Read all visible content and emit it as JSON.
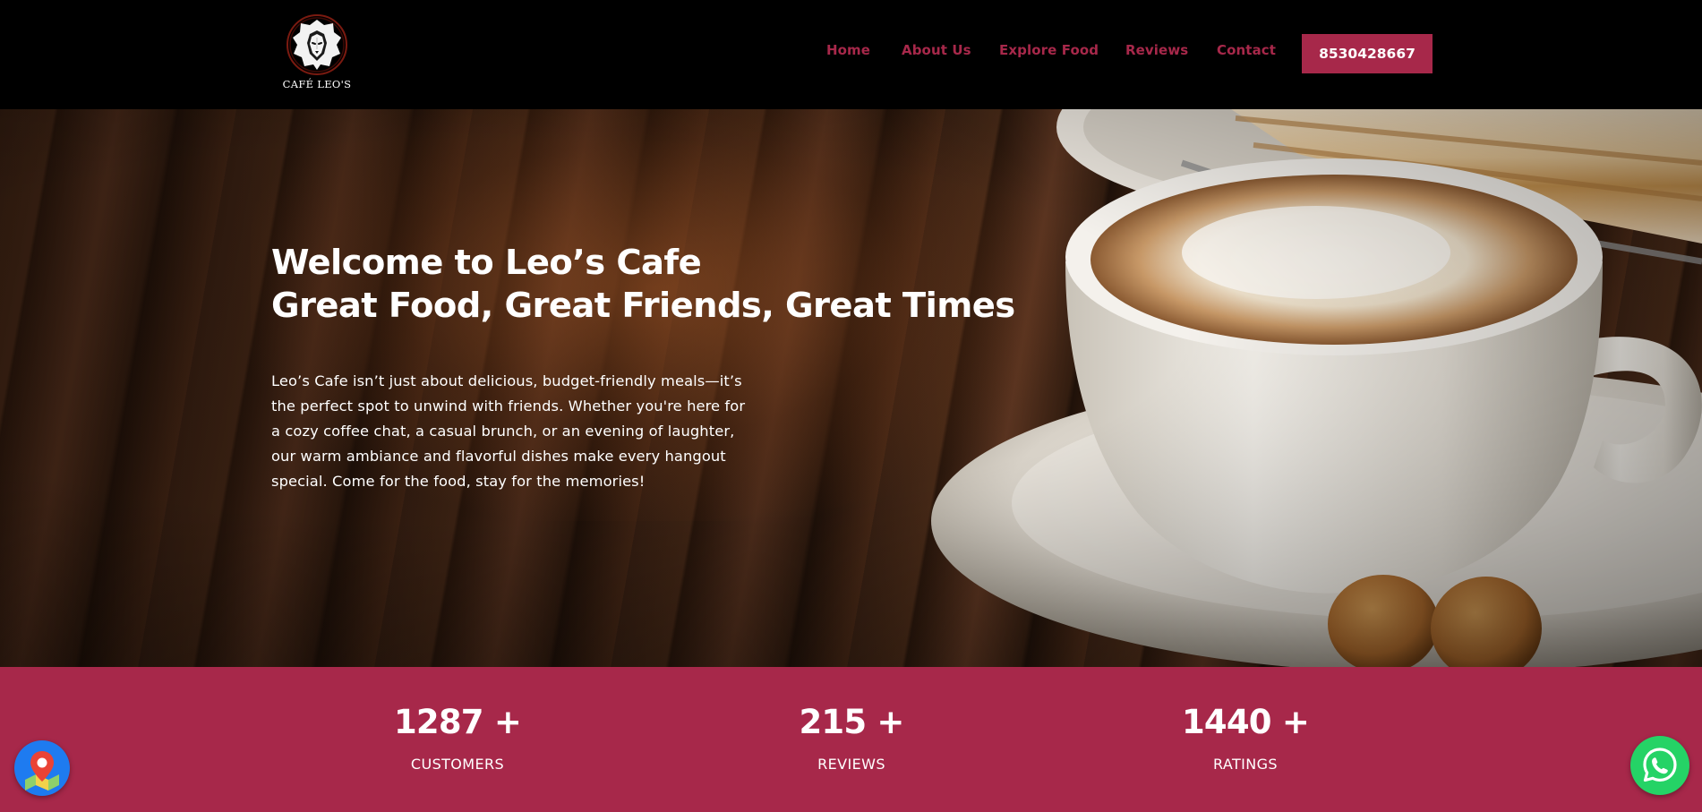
{
  "brand": {
    "logo_text": "CAFÉ LEO'S",
    "icon": "lion-icon"
  },
  "nav": {
    "items": [
      {
        "label": "Home"
      },
      {
        "label": "About Us"
      },
      {
        "label": "Explore Food"
      },
      {
        "label": "Reviews"
      },
      {
        "label": "Contact"
      }
    ],
    "phone_button": "8530428667"
  },
  "hero": {
    "title_line1": "Welcome to Leo’s Cafe",
    "title_line2": "Great Food, Great Friends, Great Times",
    "description": "Leo’s Cafe isn’t just about delicious, budget-friendly meals—it’s the perfect spot to unwind with friends. Whether you're here for a cozy coffee chat, a casual brunch, or an evening of laughter, our warm ambiance and flavorful dishes make every hangout special. Come for the food, stay for the memories!",
    "image": "cappuccino-cup-image"
  },
  "stats": [
    {
      "value": "1287 +",
      "label": "CUSTOMERS"
    },
    {
      "value": "215 +",
      "label": "REVIEWS"
    },
    {
      "value": "1440 +",
      "label": "RATINGS"
    }
  ],
  "floating": {
    "map_icon": "map-pin-icon",
    "whatsapp_icon": "whatsapp-icon"
  },
  "colors": {
    "accent": "#a7284a",
    "header_bg": "#000000",
    "whatsapp": "#25d366",
    "map_button": "#1e7bf0"
  }
}
